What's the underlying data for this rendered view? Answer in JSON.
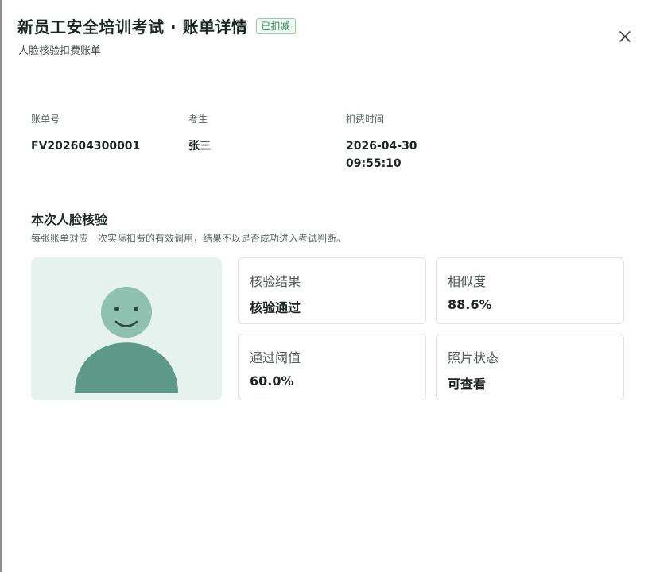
{
  "header": {
    "title": "新员工安全培训考试 · 账单详情",
    "badge": "已扣减",
    "subtitle": "人脸核验扣费账单",
    "close_icon": "close-icon"
  },
  "meta": {
    "bill_no": {
      "label": "账单号",
      "value": "FV202604300001"
    },
    "examinee": {
      "label": "考生",
      "value": "张三"
    },
    "charge_time": {
      "label": "扣费时间",
      "date": "2026-04-30",
      "time": "09:55:10"
    }
  },
  "verification": {
    "title": "本次人脸核验",
    "description": "每张账单对应一次实际扣费的有效调用，结果不以是否成功进入考试判断。",
    "photo_icon": "avatar-placeholder-icon",
    "cards": {
      "result": {
        "label": "核验结果",
        "value": "核验通过"
      },
      "similarity": {
        "label": "相似度",
        "value": "88.6%"
      },
      "threshold": {
        "label": "通过阈值",
        "value": "60.0%"
      },
      "photo_status": {
        "label": "照片状态",
        "value": "可查看"
      }
    }
  },
  "colors": {
    "accent_green": "#2f8a55",
    "avatar_body": "#5e9988",
    "avatar_head": "#8fc1b1",
    "photo_bg": "#e6f2ee"
  }
}
